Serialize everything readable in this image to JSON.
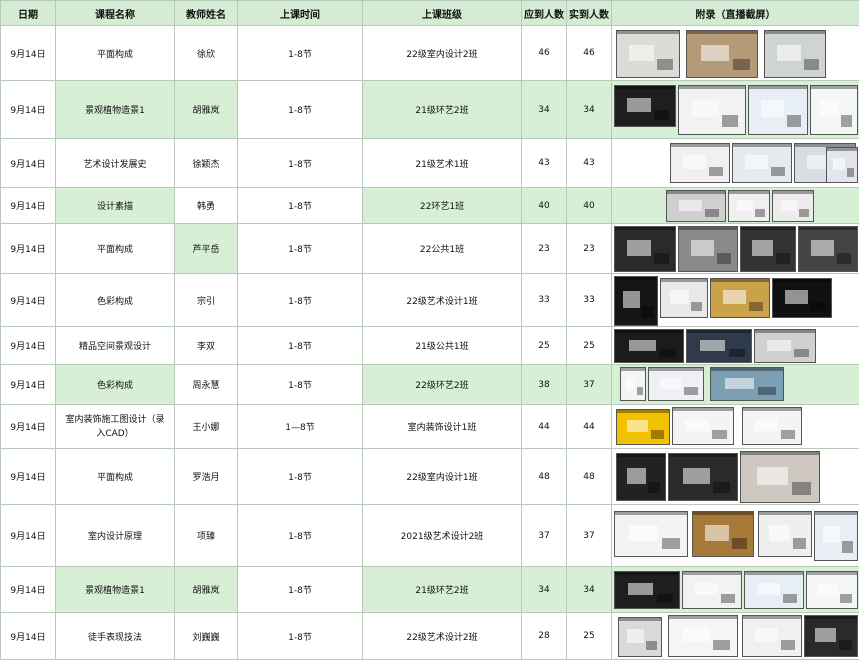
{
  "headers": {
    "date": "日期",
    "course": "课程名称",
    "teacher": "教师姓名",
    "time": "上课时间",
    "class": "上课班级",
    "expected": "应到人数",
    "actual": "实到人数",
    "appendix": "附录（直播截屏）"
  },
  "rows": [
    {
      "date": "9月14日",
      "course": "平面构成",
      "teacher": "徐欣",
      "time": "1-8节",
      "class": "22级室内设计2班",
      "expected": "46",
      "actual": "46",
      "thumbs": [
        {
          "bg": "#dcdcd6"
        },
        {
          "bg": "#b59a78"
        },
        {
          "bg": "#cfd4d2"
        }
      ]
    },
    {
      "date": "9月14日",
      "course": "景观植物造景1",
      "teacher": "胡雅岚",
      "time": "1-8节",
      "class": "21级环艺2班",
      "expected": "34",
      "actual": "34",
      "thumbs": [
        {
          "bg": "#1e1e1e"
        },
        {
          "bg": "#f2f2f2"
        },
        {
          "bg": "#e8eef6"
        },
        {
          "bg": "#f4f6f8"
        }
      ]
    },
    {
      "date": "9月14日",
      "course": "艺术设计发展史",
      "teacher": "徐颖杰",
      "time": "1-8节",
      "class": "21级艺术1班",
      "expected": "43",
      "actual": "43",
      "thumbs": [
        {
          "bg": "#f0f0f0"
        },
        {
          "bg": "#e6e9ee"
        },
        {
          "bg": "#d8dde4"
        },
        {
          "bg": "#e2e6ec"
        }
      ]
    },
    {
      "date": "9月14日",
      "course": "设计素描",
      "teacher": "韩勇",
      "time": "1-8节",
      "class": "22环艺1班",
      "expected": "40",
      "actual": "40",
      "thumbs": [
        {
          "bg": "#cfcfcf"
        },
        {
          "bg": "#f0f0f0"
        },
        {
          "bg": "#ececec"
        }
      ]
    },
    {
      "date": "9月14日",
      "course": "平面构成",
      "teacher": "芦平岳",
      "time": "1-8节",
      "class": "22公共1班",
      "expected": "23",
      "actual": "23",
      "thumbs": [
        {
          "bg": "#2a2a2a"
        },
        {
          "bg": "#8a8a8a"
        },
        {
          "bg": "#333333"
        },
        {
          "bg": "#444444"
        }
      ]
    },
    {
      "date": "9月14日",
      "course": "色彩构成",
      "teacher": "宗引",
      "time": "1-8节",
      "class": "22级艺术设计1班",
      "expected": "33",
      "actual": "33",
      "thumbs": [
        {
          "bg": "#151515"
        },
        {
          "bg": "#e8e8e8"
        },
        {
          "bg": "#c9a24a"
        },
        {
          "bg": "#101010"
        }
      ]
    },
    {
      "date": "9月14日",
      "course": "精品空间景观设计",
      "teacher": "李双",
      "time": "1-8节",
      "class": "21级公共1班",
      "expected": "25",
      "actual": "25",
      "thumbs": [
        {
          "bg": "#1b1b1b"
        },
        {
          "bg": "#2f3a4a"
        },
        {
          "bg": "#d0d0d0"
        }
      ]
    },
    {
      "date": "9月14日",
      "course": "色彩构成",
      "teacher": "周永慧",
      "time": "1-8节",
      "class": "22级环艺2班",
      "expected": "38",
      "actual": "37",
      "thumbs": [
        {
          "bg": "#f4f4f4"
        },
        {
          "bg": "#eef0f3"
        },
        {
          "bg": "#7d9fb3"
        }
      ]
    },
    {
      "date": "9月14日",
      "course": "室内装饰施工图设计（录入CAD）",
      "teacher": "王小娜",
      "time": "1—8节",
      "class": "室内装饰设计1班",
      "expected": "44",
      "actual": "44",
      "thumbs": [
        {
          "bg": "#f2c200"
        },
        {
          "bg": "#f4f4f4"
        },
        {
          "bg": "#f4f4f4"
        }
      ]
    },
    {
      "date": "9月14日",
      "course": "平面构成",
      "teacher": "罗浩月",
      "time": "1-8节",
      "class": "22级室内设计1班",
      "expected": "48",
      "actual": "48",
      "thumbs": [
        {
          "bg": "#222222"
        },
        {
          "bg": "#2a2a2a"
        },
        {
          "bg": "#cfc8c0"
        }
      ]
    },
    {
      "date": "9月14日",
      "course": "室内设计原理",
      "teacher": "项臻",
      "time": "1-8节",
      "class": "2021级艺术设计2班",
      "expected": "37",
      "actual": "37",
      "thumbs": [
        {
          "bg": "#f3f3f3"
        },
        {
          "bg": "#a87a3a"
        },
        {
          "bg": "#efefef"
        },
        {
          "bg": "#e8eef4"
        }
      ]
    },
    {
      "date": "9月14日",
      "course": "景观植物造景1",
      "teacher": "胡雅岚",
      "time": "1-8节",
      "class": "21级环艺2班",
      "expected": "34",
      "actual": "34",
      "thumbs": [
        {
          "bg": "#1e1e1e"
        },
        {
          "bg": "#f2f2f2"
        },
        {
          "bg": "#e8eef6"
        },
        {
          "bg": "#f4f6f8"
        }
      ]
    },
    {
      "date": "9月14日",
      "course": "徒手表现技法",
      "teacher": "刘巍巍",
      "time": "1-8节",
      "class": "22级艺术设计2班",
      "expected": "28",
      "actual": "25",
      "thumbs": [
        {
          "bg": "#d9d9d9"
        },
        {
          "bg": "#f5f5f5"
        },
        {
          "bg": "#f0f0f0"
        },
        {
          "bg": "#2a2a2a"
        }
      ]
    }
  ]
}
